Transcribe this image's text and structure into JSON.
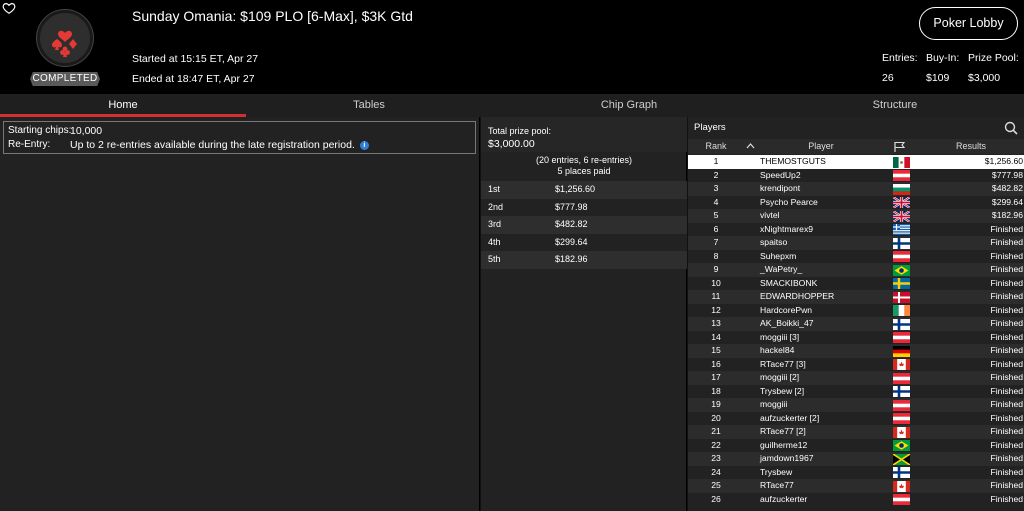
{
  "header": {
    "title": "Sunday Omania: $109 PLO [6-Max], $3K Gtd",
    "started": "Started at 15:15 ET, Apr 27",
    "ended": "Ended at 18:47 ET, Apr 27",
    "status": "COMPLETED",
    "lobby_button": "Poker Lobby",
    "stats": {
      "entries_label": "Entries:",
      "entries_value": "26",
      "buyin_label": "Buy-In:",
      "buyin_value": "$109",
      "prize_label": "Prize Pool:",
      "prize_value": "$3,000"
    },
    "brand_color": "#e53935"
  },
  "tabs": [
    {
      "label": "Home",
      "active": true
    },
    {
      "label": "Tables",
      "active": false
    },
    {
      "label": "Chip Graph",
      "active": false
    },
    {
      "label": "Structure",
      "active": false
    }
  ],
  "home": {
    "starting_chips_label": "Starting chips:",
    "starting_chips_value": "10,000",
    "reentry_label": "Re-Entry:",
    "reentry_value": "Up to 2 re-entries available during the late registration period."
  },
  "prize": {
    "label": "Total prize pool:",
    "total": "$3,000.00",
    "entries_note": "(20 entries, 6 re-entries)",
    "places_note": "5 places paid",
    "places": [
      {
        "pos": "1st",
        "amount": "$1,256.60"
      },
      {
        "pos": "2nd",
        "amount": "$777.98"
      },
      {
        "pos": "3rd",
        "amount": "$482.82"
      },
      {
        "pos": "4th",
        "amount": "$299.64"
      },
      {
        "pos": "5th",
        "amount": "$182.96"
      }
    ]
  },
  "players": {
    "title": "Players",
    "columns": {
      "rank": "Rank",
      "player": "Player",
      "results": "Results"
    },
    "rows": [
      {
        "rank": "1",
        "name": "THEMOSTGUTS",
        "flag": "mexico",
        "result": "$1,256.60"
      },
      {
        "rank": "2",
        "name": "SpeedUp2",
        "flag": "austria",
        "result": "$777.98"
      },
      {
        "rank": "3",
        "name": "krendipont",
        "flag": "bulgaria",
        "result": "$482.82"
      },
      {
        "rank": "4",
        "name": "Psycho Pearce",
        "flag": "uk",
        "result": "$299.64"
      },
      {
        "rank": "5",
        "name": "vivtel",
        "flag": "uk",
        "result": "$182.96"
      },
      {
        "rank": "6",
        "name": "xNightmarex9",
        "flag": "greece",
        "result": "Finished"
      },
      {
        "rank": "7",
        "name": "spaitso",
        "flag": "finland",
        "result": "Finished"
      },
      {
        "rank": "8",
        "name": "Suhepxm",
        "flag": "austria",
        "result": "Finished"
      },
      {
        "rank": "9",
        "name": "_WaPetry_",
        "flag": "brazil",
        "result": "Finished"
      },
      {
        "rank": "10",
        "name": "SMACKIBONK",
        "flag": "sweden",
        "result": "Finished"
      },
      {
        "rank": "11",
        "name": "EDWARDHOPPER",
        "flag": "denmark",
        "result": "Finished"
      },
      {
        "rank": "12",
        "name": "HardcorePwn",
        "flag": "ireland",
        "result": "Finished"
      },
      {
        "rank": "13",
        "name": "AK_Boikki_47",
        "flag": "finland",
        "result": "Finished"
      },
      {
        "rank": "14",
        "name": "moggiii [3]",
        "flag": "austria",
        "result": "Finished"
      },
      {
        "rank": "15",
        "name": "hackel84",
        "flag": "germany",
        "result": "Finished"
      },
      {
        "rank": "16",
        "name": "RTace77 [3]",
        "flag": "canada",
        "result": "Finished"
      },
      {
        "rank": "17",
        "name": "moggiii [2]",
        "flag": "austria",
        "result": "Finished"
      },
      {
        "rank": "18",
        "name": "Trysbew [2]",
        "flag": "finland",
        "result": "Finished"
      },
      {
        "rank": "19",
        "name": "moggiii",
        "flag": "austria",
        "result": "Finished"
      },
      {
        "rank": "20",
        "name": "aufzuckerter [2]",
        "flag": "austria",
        "result": "Finished"
      },
      {
        "rank": "21",
        "name": "RTace77 [2]",
        "flag": "canada",
        "result": "Finished"
      },
      {
        "rank": "22",
        "name": "guilherme12",
        "flag": "brazil",
        "result": "Finished"
      },
      {
        "rank": "23",
        "name": "jamdown1967",
        "flag": "jamaica",
        "result": "Finished"
      },
      {
        "rank": "24",
        "name": "Trysbew",
        "flag": "finland",
        "result": "Finished"
      },
      {
        "rank": "25",
        "name": "RTace77",
        "flag": "canada",
        "result": "Finished"
      },
      {
        "rank": "26",
        "name": "aufzuckerter",
        "flag": "austria",
        "result": "Finished"
      }
    ]
  }
}
